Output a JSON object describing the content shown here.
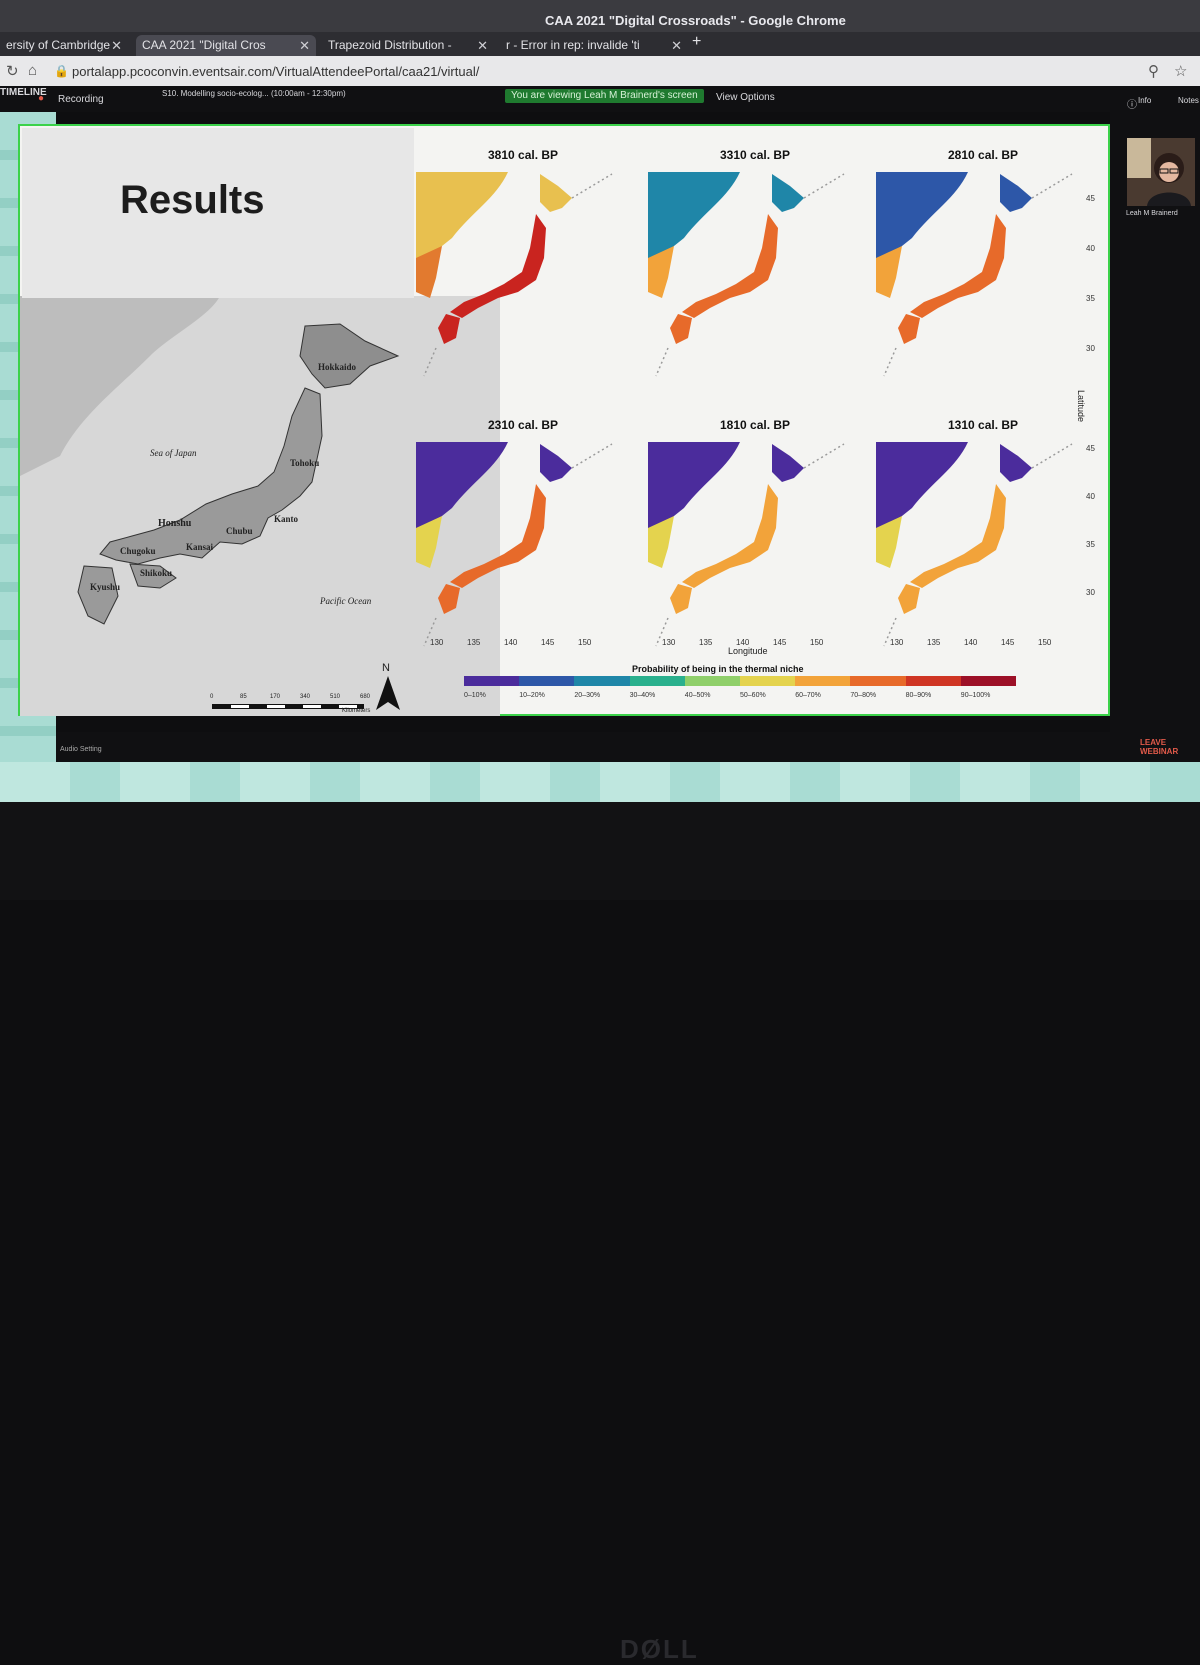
{
  "window_title": "CAA 2021 \"Digital Crossroads\" - Google Chrome",
  "tabs": [
    {
      "label": "ersity of Cambridge",
      "active": false
    },
    {
      "label": "CAA 2021 \"Digital Cros",
      "active": true
    },
    {
      "label": "Trapezoid Distribution -",
      "active": false
    },
    {
      "label": "r - Error in rep: invalide 'ti",
      "active": false
    }
  ],
  "address": "portalapp.pcoconvin.eventsair.com/VirtualAttendeePortal/caa21/virtual/",
  "webinar": {
    "timeline": "TIMELINE",
    "recording": "Recording",
    "session": "S10. Modelling socio-ecolog... (10:00am - 12:30pm)",
    "viewing": "You are viewing Leah M Brainerd's screen",
    "view_options": "View Options",
    "info": "Info",
    "notes": "Notes",
    "presenter_name": "Leah M Brainerd",
    "audio_settings": "Audio Setting",
    "leave": "LEAVE WEBINAR"
  },
  "slide": {
    "title": "Results",
    "map_labels": {
      "hokkaido": "Hokkaido",
      "sea_of_japan": "Sea of Japan",
      "tohoku": "Tohoku",
      "honshu": "Honshu",
      "kanto": "Kanto",
      "chubu": "Chubu",
      "kansai": "Kansai",
      "chugoku": "Chugoku",
      "shikoku": "Shikoku",
      "kyushu": "Kyushu",
      "pacific_ocean": "Pacific Ocean",
      "north": "N",
      "scale_km": "Kilometers",
      "scale_ticks": [
        "0",
        "85",
        "170",
        "340",
        "510",
        "680"
      ]
    },
    "panels": [
      "3810 cal. BP",
      "3310 cal. BP",
      "2810 cal. BP",
      "2310 cal. BP",
      "1810 cal. BP",
      "1310 cal. BP"
    ],
    "x_ticks": [
      "130",
      "135",
      "140",
      "145",
      "150"
    ],
    "y_ticks_top": [
      "45",
      "40",
      "35",
      "30"
    ],
    "y_ticks_bottom": [
      "45",
      "40",
      "35",
      "30"
    ],
    "xlabel": "Longitude",
    "ylabel": "Latitude",
    "legend_title": "Probability of being in the thermal niche",
    "legend": [
      "0–10%",
      "10–20%",
      "20–30%",
      "30–40%",
      "40–50%",
      "50–60%",
      "60–70%",
      "70–80%",
      "80–90%",
      "90–100%"
    ],
    "legend_colors": [
      "#4b2c9c",
      "#2d57a8",
      "#1f86a8",
      "#2ab08d",
      "#8fcf6a",
      "#e4d34e",
      "#f2a33a",
      "#e76a2a",
      "#cf3524",
      "#9c1027"
    ],
    "panel_palettes": [
      {
        "sea_block": "#e8c04f",
        "sea_low": "#e27a2f",
        "land": "#c9241f"
      },
      {
        "sea_block": "#1f86a8",
        "sea_low": "#f2a33a",
        "land": "#e76a2a"
      },
      {
        "sea_block": "#2d57a8",
        "sea_low": "#f2a33a",
        "land": "#e76a2a"
      },
      {
        "sea_block": "#4b2c9c",
        "sea_low": "#e4d34e",
        "land": "#e76a2a"
      },
      {
        "sea_block": "#4b2c9c",
        "sea_low": "#e4d34e",
        "land": "#f2a33a"
      },
      {
        "sea_block": "#4b2c9c",
        "sea_low": "#e4d34e",
        "land": "#f2a33a"
      }
    ]
  },
  "bezel_brand": "DØLL"
}
